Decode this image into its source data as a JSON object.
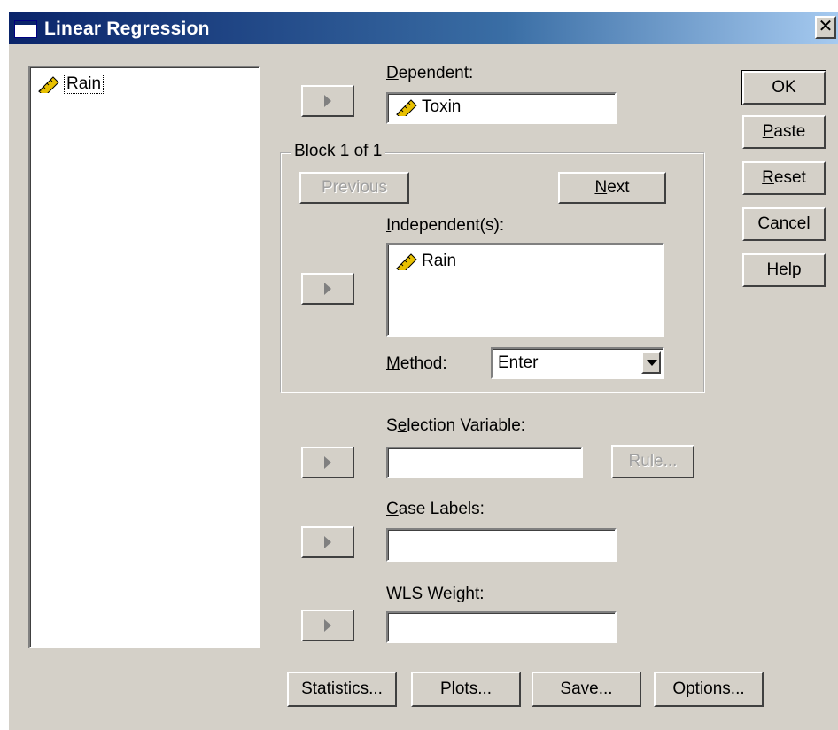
{
  "window": {
    "title": "Linear Regression",
    "close_glyph": "✕"
  },
  "source_list": {
    "items": [
      {
        "label": "Rain",
        "icon": "ruler-pencil-icon"
      }
    ]
  },
  "dependent": {
    "label": "Dependent:",
    "value": "Toxin",
    "icon": "ruler-pencil-icon"
  },
  "block": {
    "label": "Block 1 of 1",
    "previous_label": "Previous",
    "next_label": "Next",
    "independents_label": "Independent(s):",
    "independents": [
      {
        "label": "Rain",
        "icon": "ruler-pencil-icon"
      }
    ],
    "method_label": "Method:",
    "method_value": "Enter"
  },
  "selection_variable": {
    "label": "Selection Variable:",
    "value": "",
    "rule_label": "Rule..."
  },
  "case_labels": {
    "label": "Case Labels:",
    "value": ""
  },
  "wls_weight": {
    "label": "WLS Weight:",
    "value": ""
  },
  "side_buttons": {
    "ok": "OK",
    "paste": "Paste",
    "reset": "Reset",
    "cancel": "Cancel",
    "help": "Help"
  },
  "bottom_buttons": {
    "statistics": "Statistics...",
    "plots": "Plots...",
    "save": "Save...",
    "options": "Options..."
  },
  "colors": {
    "dialog_bg": "#d4d0c8",
    "title_start": "#0a246a",
    "title_end": "#a6caf0"
  }
}
